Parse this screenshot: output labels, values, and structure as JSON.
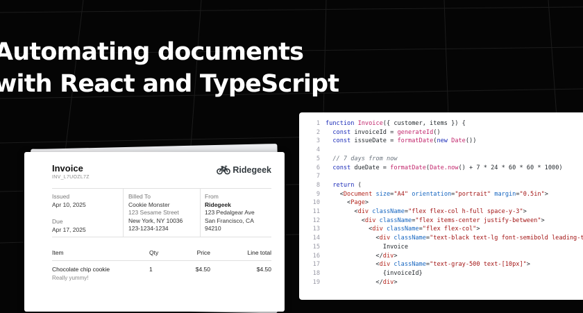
{
  "headline": {
    "line1": "Automating documents",
    "line2": "with React and TypeScript"
  },
  "invoice": {
    "title": "Invoice",
    "id": "INV_L7UOZL7Z",
    "brand": {
      "name": "Ridegeek",
      "icon": "bicycle-icon"
    },
    "issued": {
      "label": "Issued",
      "value": "Apr 10, 2025"
    },
    "due": {
      "label": "Due",
      "value": "Apr 17, 2025"
    },
    "billed_to": {
      "label": "Billed To",
      "name": "Cookie Monster",
      "address1": "123 Sesame Street",
      "address2": "New York, NY 10036",
      "phone": "123-1234-1234"
    },
    "from": {
      "label": "From",
      "name": "Ridegeek",
      "address1": "123 Pedalgear Ave",
      "address2": "San Francisco, CA",
      "zip": "94210"
    },
    "table": {
      "headers": {
        "item": "Item",
        "qty": "Qty",
        "price": "Price",
        "total": "Line total"
      },
      "rows": [
        {
          "item": "Chocolate chip cookie",
          "note": "Really yummy!",
          "qty": "1",
          "price": "$4.50",
          "total": "$4.50"
        }
      ]
    }
  },
  "code": {
    "lines": [
      [
        [
          "kw",
          "function "
        ],
        [
          "fn",
          "Invoice"
        ],
        [
          "",
          "({ customer, items }) {"
        ]
      ],
      [
        [
          "",
          "  "
        ],
        [
          "kw",
          "const"
        ],
        [
          "",
          " invoiceId = "
        ],
        [
          "fn",
          "generateId"
        ],
        [
          "",
          "()"
        ]
      ],
      [
        [
          "",
          "  "
        ],
        [
          "kw",
          "const"
        ],
        [
          "",
          " issueDate = "
        ],
        [
          "fn",
          "formatDate"
        ],
        [
          "",
          "("
        ],
        [
          "kw",
          "new"
        ],
        [
          "",
          ""
        ],
        [
          "fn",
          " Date"
        ],
        [
          "",
          "())"
        ]
      ],
      [],
      [
        [
          "cm",
          "  // 7 days from now"
        ]
      ],
      [
        [
          "",
          "  "
        ],
        [
          "kw",
          "const"
        ],
        [
          "",
          " dueDate = "
        ],
        [
          "fn",
          "formatDate"
        ],
        [
          "",
          "("
        ],
        [
          "fn",
          "Date.now"
        ],
        [
          "",
          "() + 7 * 24 * 60 * 60 * 1000)"
        ]
      ],
      [],
      [
        [
          "",
          "  "
        ],
        [
          "kw",
          "return"
        ],
        [
          "",
          " ("
        ]
      ],
      [
        [
          "",
          "    <"
        ],
        [
          "tag",
          "Document"
        ],
        [
          "",
          " "
        ],
        [
          "attr",
          "size"
        ],
        [
          "",
          "="
        ],
        [
          "str",
          "\"A4\""
        ],
        [
          "",
          " "
        ],
        [
          "attr",
          "orientation"
        ],
        [
          "",
          "="
        ],
        [
          "str",
          "\"portrait\""
        ],
        [
          "",
          " "
        ],
        [
          "attr",
          "margin"
        ],
        [
          "",
          "="
        ],
        [
          "str",
          "\"0.5in\""
        ],
        [
          "",
          ">"
        ]
      ],
      [
        [
          "",
          "      <"
        ],
        [
          "tag",
          "Page"
        ],
        [
          "",
          ">"
        ]
      ],
      [
        [
          "",
          "        <"
        ],
        [
          "tag",
          "div"
        ],
        [
          "",
          " "
        ],
        [
          "attr",
          "className"
        ],
        [
          "",
          "="
        ],
        [
          "str",
          "\"flex flex-col h-full space-y-3\""
        ],
        [
          "",
          ">"
        ]
      ],
      [
        [
          "",
          "          <"
        ],
        [
          "tag",
          "div"
        ],
        [
          "",
          " "
        ],
        [
          "attr",
          "className"
        ],
        [
          "",
          "="
        ],
        [
          "str",
          "\"flex items-center justify-between\""
        ],
        [
          "",
          ">"
        ]
      ],
      [
        [
          "",
          "            <"
        ],
        [
          "tag",
          "div"
        ],
        [
          "",
          " "
        ],
        [
          "attr",
          "className"
        ],
        [
          "",
          "="
        ],
        [
          "str",
          "\"flex flex-col\""
        ],
        [
          "",
          ">"
        ]
      ],
      [
        [
          "",
          "              <"
        ],
        [
          "tag",
          "div"
        ],
        [
          "",
          " "
        ],
        [
          "attr",
          "className"
        ],
        [
          "",
          "="
        ],
        [
          "str",
          "\"text-black text-lg font-semibold leading-tight\""
        ],
        [
          "",
          ">"
        ]
      ],
      [
        [
          "",
          "                Invoice"
        ]
      ],
      [
        [
          "",
          "              </"
        ],
        [
          "tag",
          "div"
        ],
        [
          "",
          ">"
        ]
      ],
      [
        [
          "",
          "              <"
        ],
        [
          "tag",
          "div"
        ],
        [
          "",
          " "
        ],
        [
          "attr",
          "className"
        ],
        [
          "",
          "="
        ],
        [
          "str",
          "\"text-gray-500 text-[10px]\""
        ],
        [
          "",
          ">"
        ]
      ],
      [
        [
          "",
          "                {invoiceId}"
        ]
      ],
      [
        [
          "",
          "              </"
        ],
        [
          "tag",
          "div"
        ],
        [
          "",
          ">"
        ]
      ]
    ]
  }
}
